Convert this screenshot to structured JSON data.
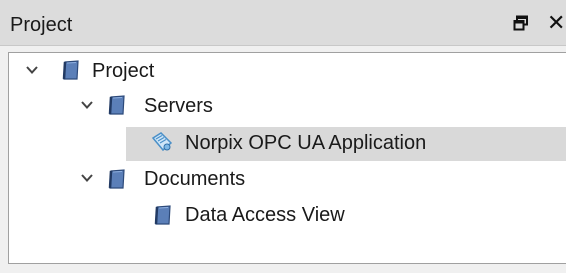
{
  "panel": {
    "title": "Project",
    "float_icon": "float-window-icon",
    "close_symbol": "✕"
  },
  "tree": {
    "root": {
      "label": "Project",
      "icon": "notebook-icon",
      "expanded": true
    },
    "servers": {
      "label": "Servers",
      "icon": "notebook-icon",
      "expanded": true
    },
    "server_item": {
      "label": "Norpix OPC UA Application",
      "icon": "server-connection-icon",
      "selected": true
    },
    "documents": {
      "label": "Documents",
      "icon": "notebook-icon",
      "expanded": true
    },
    "document_item": {
      "label": "Data Access View",
      "icon": "notebook-icon"
    }
  },
  "colors": {
    "titlebar": "#dcdcdc",
    "selection": "#d9d9d9",
    "notebook_icon": "#4a6fa5",
    "server_icon": "#5aa0d8"
  }
}
